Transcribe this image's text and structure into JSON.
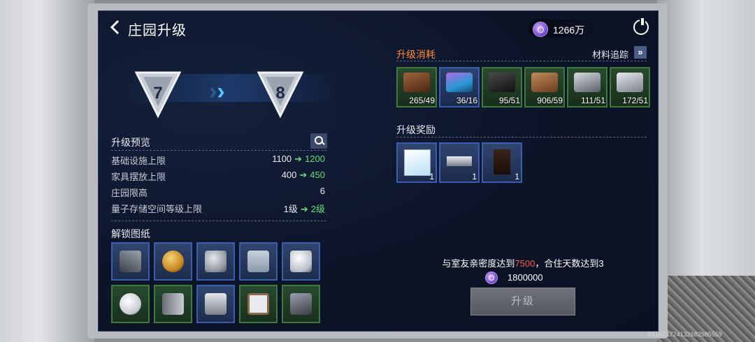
{
  "header": {
    "title": "庄园升级",
    "currency_value": "1266万"
  },
  "level": {
    "from": "7",
    "to": "8"
  },
  "preview": {
    "title": "升级预览",
    "rows": [
      {
        "label": "基础设施上限",
        "old": "1100",
        "new": "1200"
      },
      {
        "label": "家具摆放上限",
        "old": "400",
        "new": "450"
      },
      {
        "label": "庄园限高",
        "value": "6"
      },
      {
        "label": "量子存储空间等级上限",
        "old": "1级",
        "new": "2级"
      }
    ]
  },
  "blueprints": {
    "title": "解锁图纸",
    "items": [
      {
        "icon": "rifle-icon",
        "rarity": "blue"
      },
      {
        "icon": "globe-lamp-icon",
        "rarity": "blue"
      },
      {
        "icon": "armor-vest-icon",
        "rarity": "blue"
      },
      {
        "icon": "pants-icon",
        "rarity": "blue"
      },
      {
        "icon": "boots-icon",
        "rarity": "blue"
      },
      {
        "icon": "round-lamp-icon",
        "rarity": "green"
      },
      {
        "icon": "fridge-icon",
        "rarity": "green"
      },
      {
        "icon": "bed-pod-icon",
        "rarity": "blue"
      },
      {
        "icon": "screen-frame-icon",
        "rarity": "green"
      },
      {
        "icon": "treadmill-icon",
        "rarity": "green"
      }
    ]
  },
  "materials": {
    "title": "升级消耗",
    "track_label": "材料追踪",
    "items": [
      {
        "icon": "leather-icon",
        "count": "265/49",
        "rarity": "green",
        "color": "#6b3a22"
      },
      {
        "icon": "crystal-fiber-icon",
        "count": "36/16",
        "rarity": "blue",
        "color": "#2a9ad6"
      },
      {
        "icon": "chip-icon",
        "count": "95/51",
        "rarity": "green",
        "color": "#2a2a2a"
      },
      {
        "icon": "wood-log-icon",
        "count": "906/59",
        "rarity": "green",
        "color": "#8a5a34"
      },
      {
        "icon": "metal-rod-icon",
        "count": "111/51",
        "rarity": "green",
        "color": "#9aa0a8"
      },
      {
        "icon": "parts-icon",
        "count": "172/51",
        "rarity": "green",
        "color": "#b8bec6"
      }
    ]
  },
  "rewards": {
    "title": "升级奖励",
    "items": [
      {
        "icon": "painting-icon",
        "count": "1"
      },
      {
        "icon": "table-ornament-icon",
        "count": "1"
      },
      {
        "icon": "chair-icon",
        "count": "1"
      }
    ]
  },
  "requirement": {
    "prefix": "与室友亲密度达到",
    "value": "7500",
    "suffix": "，合住天数达到3"
  },
  "cost": {
    "value": "1800000"
  },
  "upgrade_label": "升级",
  "uid": "©10621724132682985559"
}
